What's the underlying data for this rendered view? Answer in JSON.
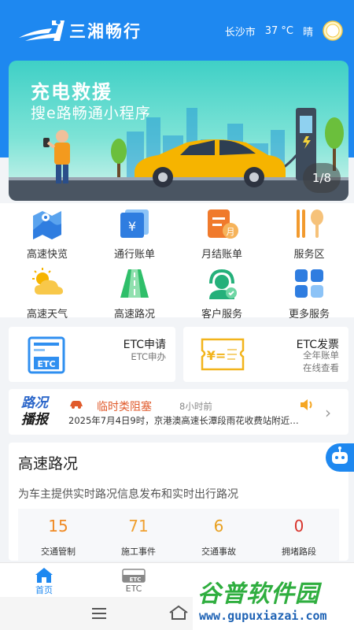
{
  "header": {
    "app_name": "三湘畅行",
    "city": "长沙市",
    "temperature": "37 °C",
    "weather": "晴",
    "weather_icon": "sun-icon"
  },
  "banner": {
    "title": "充电救援",
    "subtitle": "搜e路畅通小程序",
    "pager": "1/8"
  },
  "services": [
    {
      "label": "高速快览",
      "icon": "map-icon"
    },
    {
      "label": "通行账单",
      "icon": "yuan-bill-icon"
    },
    {
      "label": "月结账单",
      "icon": "monthly-bill-icon"
    },
    {
      "label": "服务区",
      "icon": "utensils-icon"
    },
    {
      "label": "高速天气",
      "icon": "weather-icon"
    },
    {
      "label": "高速路况",
      "icon": "road-icon"
    },
    {
      "label": "客户服务",
      "icon": "headset-icon"
    },
    {
      "label": "更多服务",
      "icon": "grid-icon"
    }
  ],
  "etc_apply": {
    "title": "ETC申请",
    "sub": "ETC申办",
    "icon_text": "ETC"
  },
  "etc_invoice": {
    "title": "ETC发票",
    "sub1": "全年账单",
    "sub2": "在线查看",
    "icon_text": "¥="
  },
  "news": {
    "logo_line1": "路况",
    "logo_line2": "播报",
    "tag": "临时类阻塞",
    "time": "8小时前",
    "text": "2025年7月4日9时，京港澳高速长潭段雨花收费站附近…"
  },
  "road": {
    "title": "高速路况",
    "desc": "为车主提供实时路况信息发布和实时出行路况",
    "stats": [
      {
        "value": "15",
        "label": "交通管制",
        "color": "#f08a24"
      },
      {
        "value": "71",
        "label": "施工事件",
        "color": "#f0a030"
      },
      {
        "value": "6",
        "label": "交通事故",
        "color": "#e8a020"
      },
      {
        "value": "0",
        "label": "拥堵路段",
        "color": "#d8342c"
      }
    ]
  },
  "tabs": [
    {
      "label": "首页",
      "active": true
    },
    {
      "label": "ETC",
      "active": false
    }
  ],
  "watermark": {
    "title": "谷普软件园",
    "url": "www.gupuxiazai.com"
  }
}
